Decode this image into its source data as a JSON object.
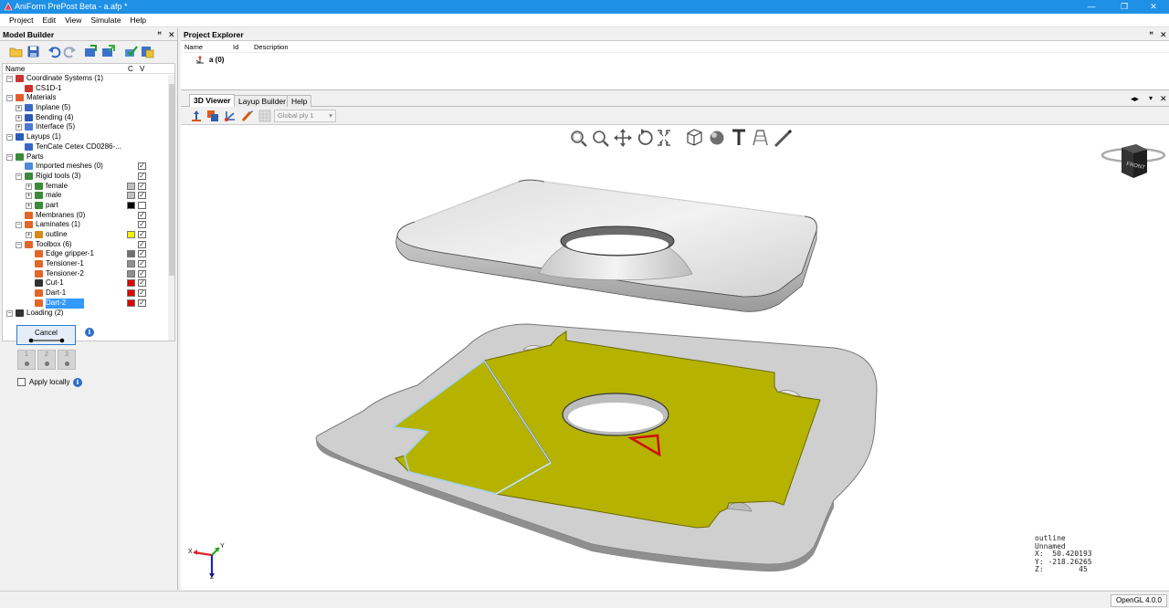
{
  "window": {
    "title": "AniForm PrePost Beta - a.afp *",
    "minimize": "—",
    "restore": "❐",
    "close": "✕"
  },
  "menu": [
    "Project",
    "Edit",
    "View",
    "Simulate",
    "Help"
  ],
  "model_builder": {
    "title": "Model Builder",
    "columns": {
      "name": "Name",
      "c": "C",
      "v": "V"
    },
    "tree": [
      {
        "label": "Coordinate Systems (1)",
        "level": 0,
        "exp": "−",
        "icon": "axes-icon"
      },
      {
        "label": "CS1D-1",
        "level": 1,
        "icon": "axes-icon"
      },
      {
        "label": "Materials",
        "level": 0,
        "exp": "−",
        "icon": "materials-icon"
      },
      {
        "label": "Inplane (5)",
        "level": 1,
        "exp": "+",
        "icon": "inplane-icon"
      },
      {
        "label": "Bending (4)",
        "level": 1,
        "exp": "+",
        "icon": "bending-icon"
      },
      {
        "label": "Interface (5)",
        "level": 1,
        "exp": "+",
        "icon": "interface-icon"
      },
      {
        "label": "Layups (1)",
        "level": 0,
        "exp": "−",
        "icon": "layups-icon"
      },
      {
        "label": "TenCate Cetex CD0286-...",
        "level": 1,
        "icon": "layup-icon"
      },
      {
        "label": "Parts",
        "level": 0,
        "exp": "−",
        "icon": "parts-icon"
      },
      {
        "label": "Imported meshes (0)",
        "level": 1,
        "icon": "mesh-icon",
        "checked": true
      },
      {
        "label": "Rigid tools (3)",
        "level": 1,
        "exp": "−",
        "icon": "tools-icon",
        "checked": true
      },
      {
        "label": "female",
        "level": 2,
        "exp": "+",
        "icon": "tool-icon",
        "color": "#c0c0c0",
        "checked": true
      },
      {
        "label": "male",
        "level": 2,
        "exp": "+",
        "icon": "tool-icon",
        "color": "#c0c0c0",
        "checked": true
      },
      {
        "label": "part",
        "level": 2,
        "exp": "+",
        "icon": "tool-icon",
        "color": "#000000",
        "checked": false
      },
      {
        "label": "Membranes (0)",
        "level": 1,
        "icon": "membrane-icon",
        "checked": true
      },
      {
        "label": "Laminates (1)",
        "level": 1,
        "exp": "−",
        "icon": "laminate-icon",
        "checked": true
      },
      {
        "label": "outline",
        "level": 2,
        "exp": "+",
        "icon": "outline-icon",
        "color": "#f5f000",
        "checked": true
      },
      {
        "label": "Toolbox (6)",
        "level": 1,
        "exp": "−",
        "icon": "toolbox-icon",
        "checked": true
      },
      {
        "label": "Edge gripper-1",
        "level": 2,
        "icon": "gripper-icon",
        "color": "#707070",
        "checked": true
      },
      {
        "label": "Tensioner-1",
        "level": 2,
        "icon": "tensioner-icon",
        "color": "#909090",
        "checked": true
      },
      {
        "label": "Tensioner-2",
        "level": 2,
        "icon": "tensioner-icon",
        "color": "#909090",
        "checked": true
      },
      {
        "label": "Cut-1",
        "level": 2,
        "icon": "cut-icon",
        "color": "#e00000",
        "checked": true
      },
      {
        "label": "Dart-1",
        "level": 2,
        "icon": "dart-icon",
        "color": "#e00000",
        "checked": true
      },
      {
        "label": "Dart-2",
        "level": 2,
        "icon": "dart-icon",
        "color": "#e00000",
        "checked": true,
        "selected": true
      },
      {
        "label": "Loading (2)",
        "level": 0,
        "exp": "−",
        "icon": "loading-icon"
      }
    ],
    "cancel_label": "Cancel",
    "steps": [
      "1",
      "2",
      "3"
    ],
    "apply_locally": "Apply locally"
  },
  "project_explorer": {
    "title": "Project Explorer",
    "columns": [
      "Name",
      "Id",
      "Description"
    ],
    "item": "a (0)"
  },
  "tabs": [
    "3D Viewer",
    "Layup Builder",
    "Help"
  ],
  "ply_select": "Global ply 1",
  "axis_labels": {
    "x": "X",
    "y": "Y",
    "z": "Z"
  },
  "view_cube_label": "FRONT",
  "readout": {
    "line1": "outline",
    "line2": "Unnamed",
    "line3": "X:  50.420193",
    "line4": "Y: -218.26265",
    "line5": "Z:        45"
  },
  "status": {
    "opengl": "OpenGL 4.0.0"
  },
  "colors": {
    "accent": "#1e90e6",
    "laminate": "#b5b300",
    "selection": "#3399ff",
    "dart": "#cc1111"
  }
}
